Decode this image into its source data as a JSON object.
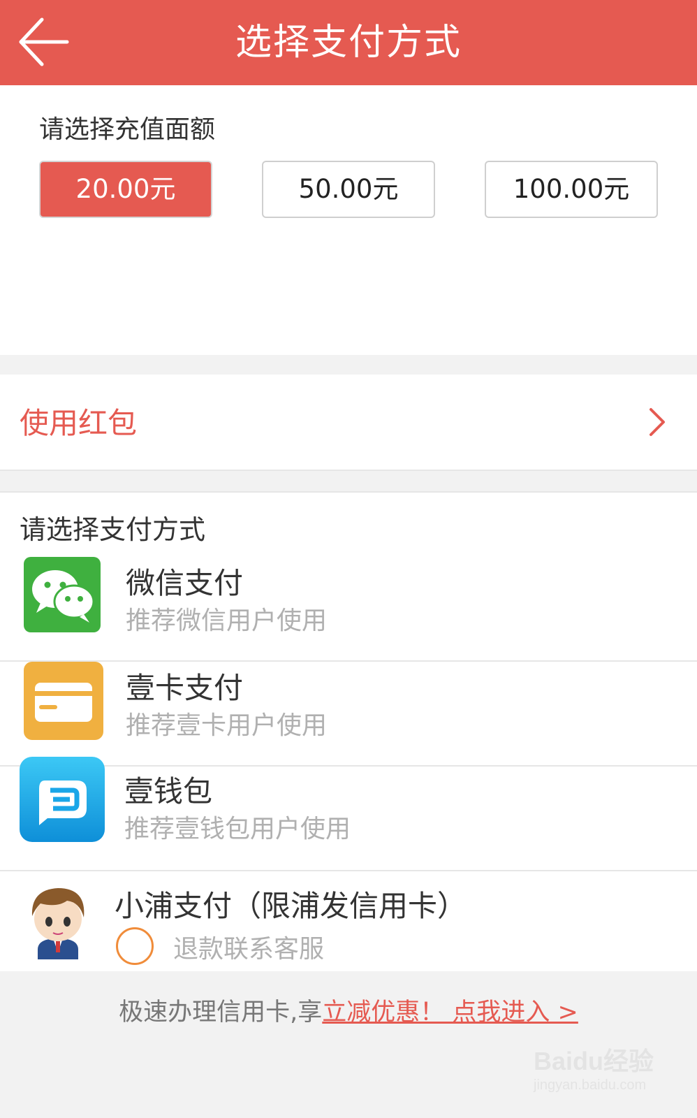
{
  "header": {
    "title": "选择支付方式",
    "back_icon": "back-arrow-icon"
  },
  "recharge": {
    "label": "请选择充值面额",
    "amounts": [
      {
        "label": "20.00元",
        "selected": true
      },
      {
        "label": "50.00元",
        "selected": false
      },
      {
        "label": "100.00元",
        "selected": false
      }
    ]
  },
  "red_packet": {
    "label": "使用红包",
    "chevron_icon": "chevron-right-icon"
  },
  "payment": {
    "label": "请选择支付方式",
    "methods": [
      {
        "name": "微信支付",
        "desc": "推荐微信用户使用",
        "icon": "wechat-icon"
      },
      {
        "name": "壹卡支付",
        "desc": "推荐壹卡用户使用",
        "icon": "card-icon"
      },
      {
        "name": "壹钱包",
        "desc": "推荐壹钱包用户使用",
        "icon": "wallet-icon"
      },
      {
        "name": "小浦支付（限浦发信用卡）",
        "desc": "退款联系客服",
        "icon": "avatar-icon",
        "selected": false
      }
    ]
  },
  "footer": {
    "text": "极速办理信用卡,享",
    "link": "立减优惠！ 点我进入 >"
  },
  "watermark": {
    "logo": "Baidu经验",
    "url": "jingyan.baidu.com"
  },
  "colors": {
    "accent": "#e55a51",
    "wechat_green": "#3fb03f",
    "card_orange": "#f0b040",
    "wallet_blue": "#1aa6e8",
    "radio_orange": "#f08c3a"
  }
}
